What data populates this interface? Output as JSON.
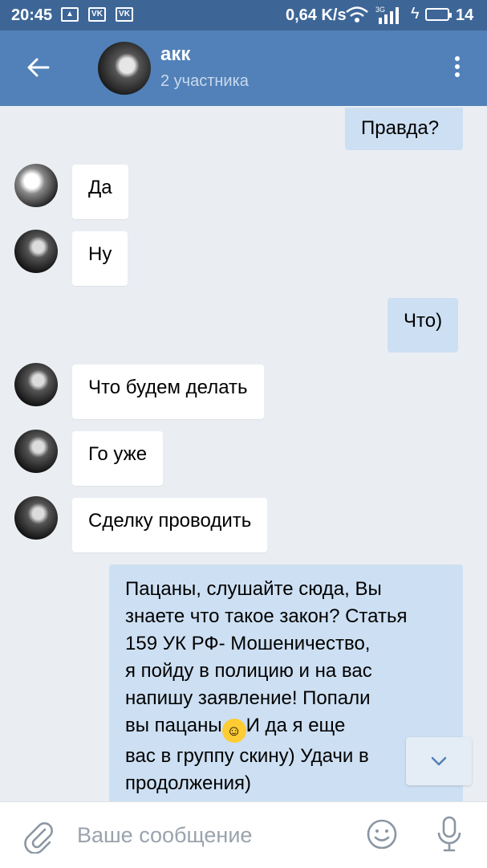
{
  "status_bar": {
    "time": "20:45",
    "speed": "0,64 K/s",
    "network": "3G",
    "battery": "14"
  },
  "header": {
    "title": "акк",
    "subtitle": "2 участника"
  },
  "messages": [
    {
      "dir": "out",
      "text": "Правда?"
    },
    {
      "dir": "in",
      "text": "Да"
    },
    {
      "dir": "in",
      "text": "Ну"
    },
    {
      "dir": "out",
      "text": "Что)"
    },
    {
      "dir": "in",
      "text": "Что будем делать"
    },
    {
      "dir": "in",
      "text": "Го уже"
    },
    {
      "dir": "in",
      "text": "Сделку проводить"
    },
    {
      "dir": "out",
      "text_before_emoji": "Пацаны, слушайте сюда, Вы\nзнаете что такое закон? Статья\n159 УК РФ- Мошеничество,\n я пойду  в полицию и на вас\nнапишу заявление!  Попали\nвы пацаны",
      "emoji": "rolling-on-floor-laughing",
      "text_after_emoji": "И да я еще\nвас в группу скину) Удачи в\nпродолжения)"
    }
  ],
  "input": {
    "placeholder": "Ваше сообщение"
  },
  "colors": {
    "status_bar": "#3d6697",
    "header": "#5181b8",
    "background": "#eaeef3",
    "bubble_in": "#ffffff",
    "bubble_out": "#cddff2",
    "icon_gray": "#8b96a3"
  }
}
